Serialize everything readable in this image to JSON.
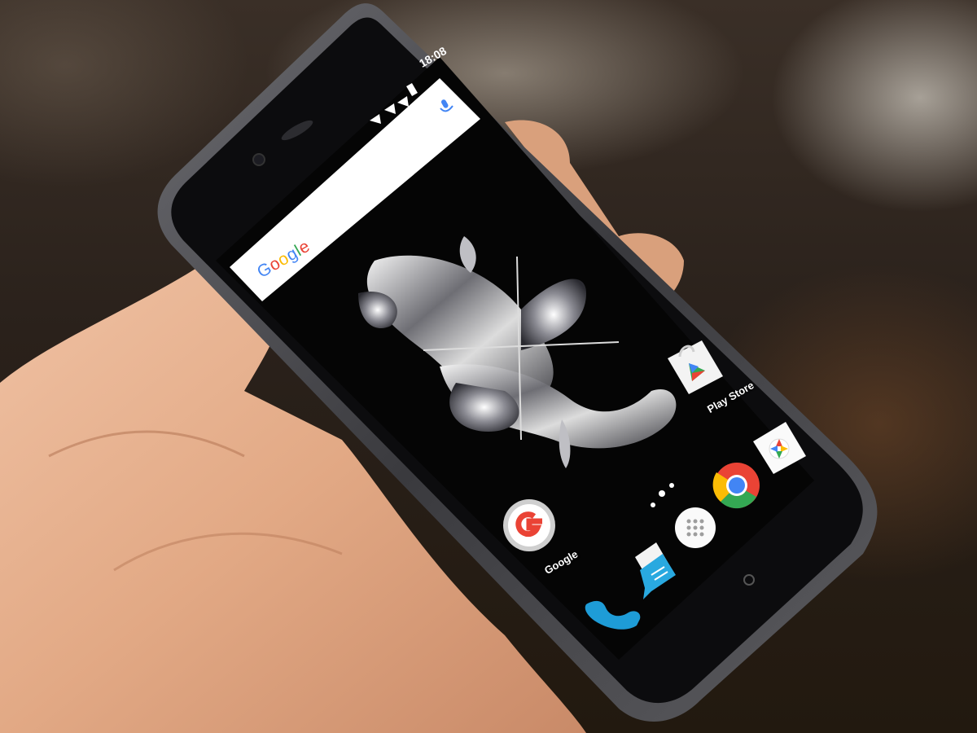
{
  "status_bar": {
    "time": "18:08"
  },
  "search_widget": {
    "logo_text": "Google",
    "logo_colors": [
      "#4285F4",
      "#EA4335",
      "#FBBC05",
      "#4285F4",
      "#34A853",
      "#EA4335"
    ],
    "mic_icon": "microphone-icon"
  },
  "home_screen": {
    "apps": [
      {
        "label": "Play Store",
        "icon": "play-store-icon"
      },
      {
        "label": "Google",
        "icon": "google-app-icon"
      }
    ],
    "dock": [
      {
        "icon": "phone-icon"
      },
      {
        "icon": "messages-icon"
      },
      {
        "icon": "app-drawer-icon"
      },
      {
        "icon": "chrome-icon"
      },
      {
        "icon": "camera-icon"
      }
    ]
  },
  "colors": {
    "phone_frame": "#4a4a4e",
    "screen": "#050505",
    "skin": "#e6b190"
  }
}
